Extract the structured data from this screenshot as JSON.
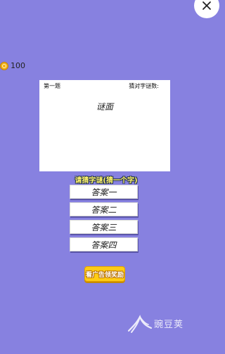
{
  "header": {
    "coin_count": "100"
  },
  "puzzle": {
    "question_number": "第一题",
    "solved_label": "猜对字谜数:",
    "riddle": "谜面"
  },
  "prompt": "请猜字谜(猜一个字)",
  "answers": [
    "答案一",
    "答案二",
    "答案三",
    "答案四"
  ],
  "ad_button_label": "看广告领奖励",
  "watermark": {
    "text": "豌豆荚"
  },
  "colors": {
    "background": "#8781e0",
    "prompt_text": "#fff46a",
    "ad_button": "#ffcc14",
    "coin": "#f2b015"
  }
}
